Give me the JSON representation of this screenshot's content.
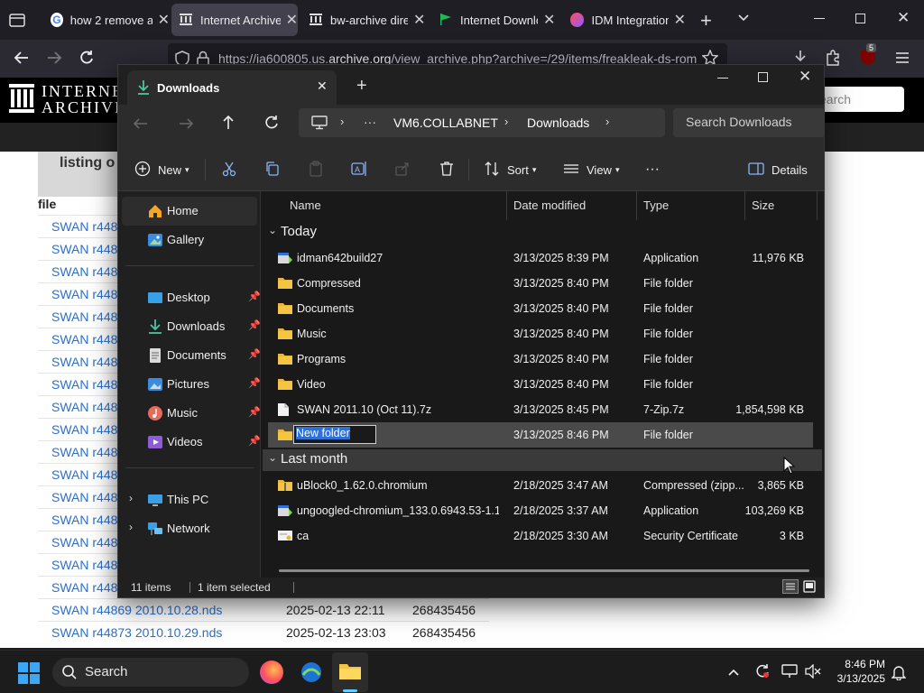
{
  "browser": {
    "tabs": [
      {
        "title": "how 2 remove a",
        "icon": "google-icon"
      },
      {
        "title": "Internet Archive",
        "icon": "archive-icon"
      },
      {
        "title": "bw-archive direc",
        "icon": "archive-icon"
      },
      {
        "title": "Internet Downlo",
        "icon": "idm-flag-icon"
      },
      {
        "title": "IDM Integration",
        "icon": "firefox-addon-icon"
      }
    ],
    "url_prefix": "https://ia600805.us.",
    "url_domain": "archive.org",
    "url_rest": "/view_archive.php?archive=/29/items/freakleak-ds-rom",
    "extension_badge": "5"
  },
  "web_page": {
    "logo_line1": "INTERNET",
    "logo_line2": "ARCHIVE",
    "search_placeholder": "earch",
    "listing_title": "listing o",
    "file_header": "file",
    "rows": [
      {
        "name": "SWAN r448",
        "date": "",
        "size": ""
      },
      {
        "name": "SWAN r448",
        "date": "",
        "size": ""
      },
      {
        "name": "SWAN r448",
        "date": "",
        "size": ""
      },
      {
        "name": "SWAN r448",
        "date": "",
        "size": ""
      },
      {
        "name": "SWAN r448",
        "date": "",
        "size": ""
      },
      {
        "name": "SWAN r448",
        "date": "",
        "size": ""
      },
      {
        "name": "SWAN r448",
        "date": "",
        "size": ""
      },
      {
        "name": "SWAN r448",
        "date": "",
        "size": ""
      },
      {
        "name": "SWAN r448",
        "date": "",
        "size": ""
      },
      {
        "name": "SWAN r448",
        "date": "",
        "size": ""
      },
      {
        "name": "SWAN r448",
        "date": "",
        "size": ""
      },
      {
        "name": "SWAN r448",
        "date": "",
        "size": ""
      },
      {
        "name": "SWAN r448",
        "date": "",
        "size": ""
      },
      {
        "name": "SWAN r448",
        "date": "",
        "size": ""
      },
      {
        "name": "SWAN r448",
        "date": "",
        "size": ""
      },
      {
        "name": "SWAN r448",
        "date": "",
        "size": ""
      },
      {
        "name": "SWAN r448",
        "date": "",
        "size": ""
      },
      {
        "name": "SWAN r44869 2010.10.28.nds",
        "date": "2025-02-13 22:11",
        "size": "268435456"
      },
      {
        "name": "SWAN r44873 2010.10.29.nds",
        "date": "2025-02-13 23:03",
        "size": "268435456"
      }
    ]
  },
  "explorer": {
    "tab_title": "Downloads",
    "breadcrumb": [
      "VM6.COLLABNET",
      "Downloads"
    ],
    "breadcrumb_ellipsis": "···",
    "search_placeholder": "Search Downloads",
    "toolbar": {
      "new_label": "New",
      "sort_label": "Sort",
      "view_label": "View",
      "more_label": "···",
      "details_label": "Details"
    },
    "sidebar": {
      "home": "Home",
      "gallery": "Gallery",
      "desktop": "Desktop",
      "downloads": "Downloads",
      "documents": "Documents",
      "pictures": "Pictures",
      "music": "Music",
      "videos": "Videos",
      "this_pc": "This PC",
      "network": "Network"
    },
    "columns": {
      "name": "Name",
      "date": "Date modified",
      "type": "Type",
      "size": "Size"
    },
    "groups": [
      {
        "label": "Today",
        "files": [
          {
            "name": "idman642build27",
            "date": "3/13/2025 8:39 PM",
            "type": "Application",
            "size": "11,976 KB",
            "icon": "installer-icon"
          },
          {
            "name": "Compressed",
            "date": "3/13/2025 8:40 PM",
            "type": "File folder",
            "size": "",
            "icon": "folder-icon"
          },
          {
            "name": "Documents",
            "date": "3/13/2025 8:40 PM",
            "type": "File folder",
            "size": "",
            "icon": "folder-icon"
          },
          {
            "name": "Music",
            "date": "3/13/2025 8:40 PM",
            "type": "File folder",
            "size": "",
            "icon": "folder-icon"
          },
          {
            "name": "Programs",
            "date": "3/13/2025 8:40 PM",
            "type": "File folder",
            "size": "",
            "icon": "folder-icon"
          },
          {
            "name": "Video",
            "date": "3/13/2025 8:40 PM",
            "type": "File folder",
            "size": "",
            "icon": "folder-icon"
          },
          {
            "name": "SWAN 2011.10 (Oct 11).7z",
            "date": "3/13/2025 8:45 PM",
            "type": "7-Zip.7z",
            "size": "1,854,598 KB",
            "icon": "file-icon"
          },
          {
            "name": "New folder",
            "date": "3/13/2025 8:46 PM",
            "type": "File folder",
            "size": "",
            "icon": "folder-icon"
          }
        ]
      },
      {
        "label": "Last month",
        "files": [
          {
            "name": "uBlock0_1.62.0.chromium",
            "date": "2/18/2025 3:47 AM",
            "type": "Compressed (zipp...",
            "size": "3,865 KB",
            "icon": "zip-folder-icon"
          },
          {
            "name": "ungoogled-chromium_133.0.6943.53-1.1...",
            "date": "2/18/2025 3:37 AM",
            "type": "Application",
            "size": "103,269 KB",
            "icon": "installer-icon"
          },
          {
            "name": "ca",
            "date": "2/18/2025 3:30 AM",
            "type": "Security Certificate",
            "size": "3 KB",
            "icon": "certificate-icon"
          }
        ]
      }
    ],
    "status": {
      "count": "11 items",
      "selection": "1 item selected"
    }
  },
  "taskbar": {
    "search_label": "Search",
    "time": "8:46 PM",
    "date": "3/13/2025"
  },
  "colors": {
    "explorer_bg": "#202020",
    "selection": "#4a4a4a",
    "folder_yellow": "#f4c542",
    "link_blue": "#2f6fc6",
    "accent_blue": "#2f6fd6"
  }
}
